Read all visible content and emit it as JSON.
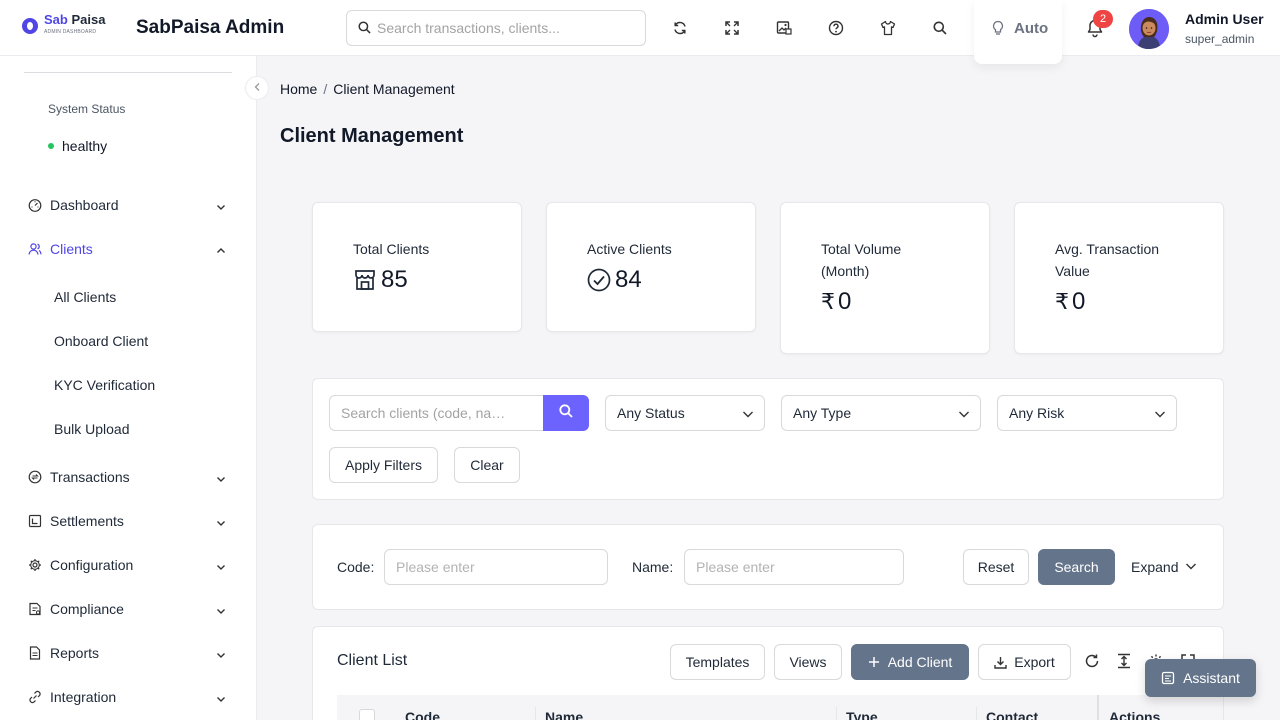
{
  "header": {
    "logo_primary": "Sab",
    "logo_secondary": "Paisa",
    "logo_sub": "ADMIN DASHBOARD",
    "app_title": "SabPaisa Admin",
    "search_placeholder": "Search transactions, clients...",
    "theme_label": "Auto",
    "notification_count": "2",
    "user_name": "Admin User",
    "user_role": "super_admin"
  },
  "sidebar": {
    "system_status_label": "System Status",
    "system_status_value": "healthy",
    "items": [
      {
        "label": "Dashboard",
        "icon": "dashboard-icon"
      },
      {
        "label": "Clients",
        "icon": "clients-icon",
        "active": true
      },
      {
        "label": "Transactions",
        "icon": "transactions-icon"
      },
      {
        "label": "Settlements",
        "icon": "settlements-icon"
      },
      {
        "label": "Configuration",
        "icon": "gear-icon"
      },
      {
        "label": "Compliance",
        "icon": "compliance-icon"
      },
      {
        "label": "Reports",
        "icon": "reports-icon"
      },
      {
        "label": "Integration",
        "icon": "integration-icon"
      }
    ],
    "client_subitems": [
      "All Clients",
      "Onboard Client",
      "KYC Verification",
      "Bulk Upload"
    ]
  },
  "breadcrumb": {
    "home": "Home",
    "separator": "/",
    "current": "Client Management"
  },
  "page_title": "Client Management",
  "stats": [
    {
      "title": "Total Clients",
      "value": "85",
      "icon": "shop-icon"
    },
    {
      "title": "Active Clients",
      "value": "84",
      "icon": "check-circle-icon"
    },
    {
      "title": "Total Volume (Month)",
      "value": "0",
      "currency": "₹"
    },
    {
      "title": "Avg. Transaction Value",
      "value": "0",
      "currency": "₹"
    }
  ],
  "filters": {
    "search_placeholder": "Search clients (code, na…",
    "status_value": "Any Status",
    "type_value": "Any Type",
    "risk_value": "Any Risk",
    "apply_label": "Apply Filters",
    "clear_label": "Clear"
  },
  "query": {
    "code_label": "Code",
    "name_label": "Name",
    "colon": ":",
    "code_placeholder": "Please enter",
    "name_placeholder": "Please enter",
    "reset_label": "Reset",
    "search_label": "Search",
    "expand_label": "Expand"
  },
  "client_list": {
    "title": "Client List",
    "templates_label": "Templates",
    "views_label": "Views",
    "add_label": "Add Client",
    "export_label": "Export",
    "columns": [
      "Code",
      "Name",
      "Type",
      "Contact",
      "Actions"
    ]
  },
  "assistant_label": "Assistant",
  "colors": {
    "accent": "#4f46e5",
    "primary_button": "#6c63ff",
    "dark_button": "#64748b",
    "status_green": "#22c55e",
    "badge_red": "#ef4444"
  }
}
